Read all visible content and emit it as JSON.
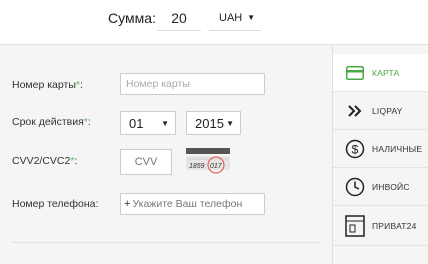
{
  "amount": {
    "label": "Сумма:",
    "value": "20",
    "currency": "UAH"
  },
  "form": {
    "card_label": "Номер карты",
    "card_required": "*",
    "card_colon": ":",
    "card_placeholder": "Номер карты",
    "expiry_label": "Срок действия",
    "expiry_required": "*",
    "expiry_colon": ":",
    "month": "01",
    "year": "2015",
    "cvv_label": "CVV2/CVC2",
    "cvv_required": "*",
    "cvv_colon": ":",
    "cvv_placeholder": "CVV",
    "card_hint_digits": "1859",
    "card_hint_cvv": "017",
    "phone_label": "Номер телефона:",
    "phone_prefix": "+",
    "phone_placeholder": "Укажите Ваш телефон"
  },
  "sidebar": {
    "items": [
      {
        "label": "КАРТА",
        "icon": "card-icon",
        "active": true
      },
      {
        "label": "LIQPAY",
        "icon": "liqpay-icon",
        "active": false
      },
      {
        "label": "НАЛИЧНЫЕ",
        "icon": "dollar-icon",
        "active": false
      },
      {
        "label": "ИНВОЙС",
        "icon": "clock-icon",
        "active": false
      },
      {
        "label": "ПРИВАТ24",
        "icon": "privat24-icon",
        "active": false
      }
    ]
  },
  "colors": {
    "accent": "#4aa944",
    "required": "#5cb85c",
    "hint_circle": "#e74c3c"
  }
}
